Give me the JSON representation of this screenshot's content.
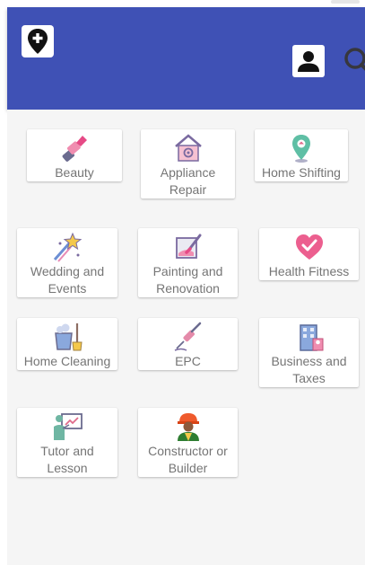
{
  "header": {
    "logo_icon": "map-pin-plus-icon",
    "account_icon": "account-icon",
    "search_icon": "search-icon",
    "background_color": "#3f51b5"
  },
  "categories": [
    {
      "label": "Beauty",
      "icon": "lipstick-icon"
    },
    {
      "label": "Appliance\nRepair",
      "icon": "appliance-house-icon"
    },
    {
      "label": "Home Shifting",
      "icon": "location-pin-icon"
    },
    {
      "label": "Wedding and\nEvents",
      "icon": "sparkle-star-icon"
    },
    {
      "label": "Painting and\nRenovation",
      "icon": "paint-brush-icon"
    },
    {
      "label": "Health Fitness",
      "icon": "heart-check-icon"
    },
    {
      "label": "Home Cleaning",
      "icon": "cleaning-bucket-icon"
    },
    {
      "label": "EPC",
      "icon": "soldering-iron-icon"
    },
    {
      "label": "Business and\nTaxes",
      "icon": "office-building-icon"
    },
    {
      "label": "Tutor and\nLesson",
      "icon": "teacher-board-icon"
    },
    {
      "label": "Constructor or\nBuilder",
      "icon": "builder-worker-icon"
    }
  ]
}
